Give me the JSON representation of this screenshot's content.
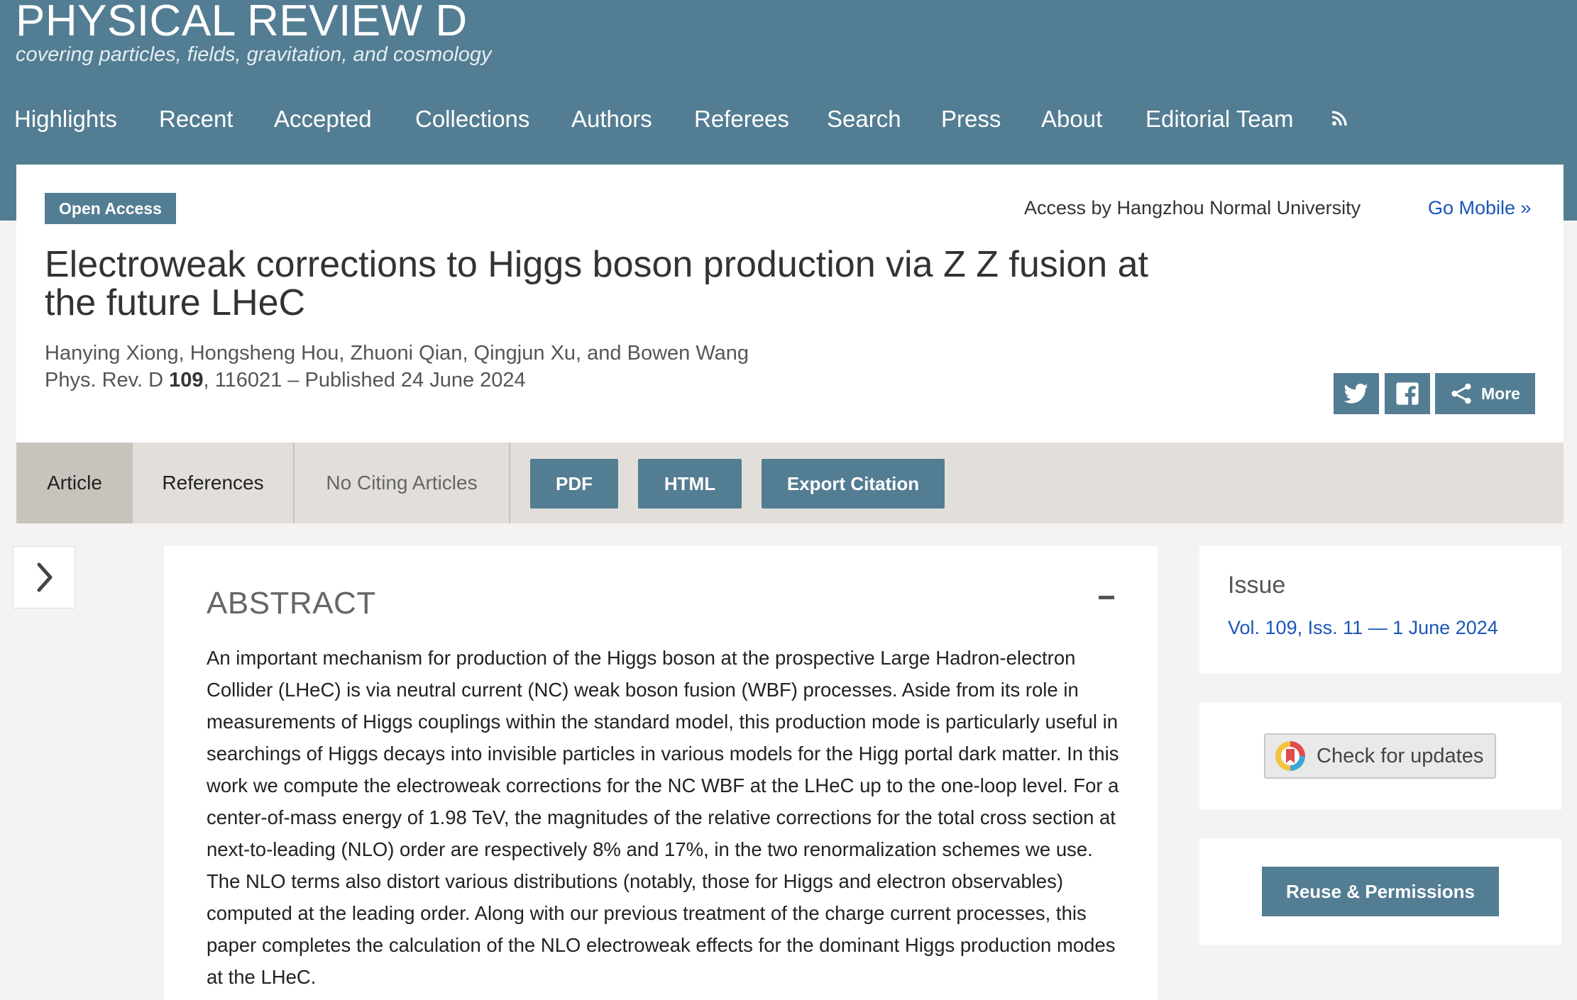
{
  "header": {
    "journal_title": "PHYSICAL REVIEW D",
    "subtitle": "covering particles, fields, gravitation, and cosmology",
    "nav": [
      "Highlights",
      "Recent",
      "Accepted",
      "Collections",
      "Authors",
      "Referees",
      "Search",
      "Press",
      "About",
      "Editorial Team"
    ],
    "rss_icon": "rss-icon"
  },
  "article": {
    "badge": "Open Access",
    "access_by": "Access by Hangzhou Normal University",
    "go_mobile": "Go Mobile »",
    "title": "Electroweak corrections to Higgs boson production via Z Z fusion at the future LHeC",
    "authors": "Hanying Xiong, Hongsheng Hou, Zhuoni Qian, Qingjun Xu, and Bowen Wang",
    "citation": {
      "journal": "Phys. Rev. D",
      "volume": "109",
      "rest": ", 116021 – Published 24 June 2024"
    },
    "share": {
      "twitter_icon": "twitter-icon",
      "facebook_icon": "facebook-icon",
      "more_label": "More"
    }
  },
  "tabs": {
    "items": [
      "Article",
      "References",
      "No Citing Articles"
    ],
    "active": "Article",
    "buttons": [
      "PDF",
      "HTML",
      "Export Citation"
    ]
  },
  "abstract": {
    "heading": "ABSTRACT",
    "collapse_label": "–",
    "text": "An important mechanism for production of the Higgs boson at the prospective Large Hadron-electron Collider (LHeC) is via neutral current (NC) weak boson fusion (WBF) processes. Aside from its role in measurements of Higgs couplings within the standard model, this production mode is particularly useful in searchings of Higgs decays into invisible particles in various models for the Higg portal dark matter. In this work we compute the electroweak corrections for the NC WBF at the LHeC up to the one-loop level. For a center-of-mass energy of 1.98 TeV, the magnitudes of the relative corrections for the total cross section at next-to-leading (NLO) order are respectively 8% and 17%, in the two renormalization schemes we use. The NLO terms also distort various distributions (notably, those for Higgs and electron observables) computed at the leading order. Along with our previous treatment of the charge current processes, this paper completes the calculation of the NLO electroweak effects for the dominant Higgs production modes at the LHeC."
  },
  "sidebar": {
    "issue_label": "Issue",
    "issue_link": "Vol. 109, Iss. 11 — 1 June 2024",
    "check_updates": "Check for updates",
    "reuse": "Reuse & Permissions"
  },
  "colors": {
    "brand": "#537d92",
    "link": "#1a56b8",
    "tab_bg": "#e2dfdb",
    "tab_active": "#c9c3bd"
  }
}
